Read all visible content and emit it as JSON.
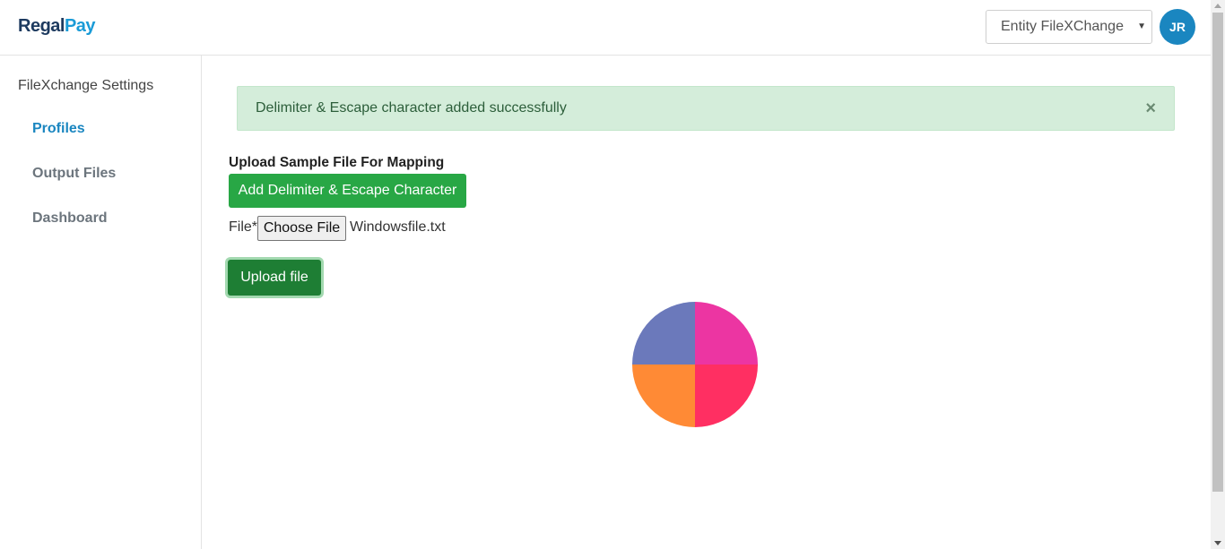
{
  "header": {
    "logo_part1": "Regal",
    "logo_part2": "Pay",
    "entity_select_value": "Entity FileXChange",
    "avatar_initials": "JR"
  },
  "sidebar": {
    "section_title": "FileXchange Settings",
    "items": [
      {
        "label": "Profiles",
        "active": true
      },
      {
        "label": "Output Files",
        "active": false
      },
      {
        "label": "Dashboard",
        "active": false
      }
    ]
  },
  "alert": {
    "message": "Delimiter & Escape character added successfully",
    "close": "×"
  },
  "main": {
    "heading": "Upload Sample File For Mapping",
    "add_button": "Add Delimiter & Escape Character",
    "file_label": "File*",
    "choose_button": "Choose File",
    "file_name": "Windowsfile.txt",
    "upload_button": "Upload file"
  },
  "colors": {
    "brand_dark": "#1d3a5f",
    "brand_blue": "#1a9bd7",
    "success_green": "#28a745",
    "pie_pink": "#ec35a2",
    "pie_red": "#ff2f62",
    "pie_orange": "#ff8a35",
    "pie_purple": "#6b79bb"
  },
  "icons": {
    "close": "close-icon",
    "caret": "caret-down-icon",
    "loader": "pie-loader-icon"
  }
}
